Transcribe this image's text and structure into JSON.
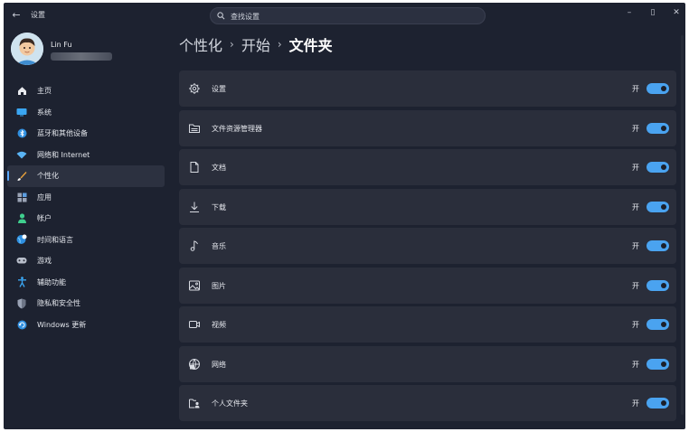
{
  "window": {
    "app_title": "设置",
    "back_glyph": "←",
    "search_placeholder": "查找设置",
    "minimize_glyph": "–",
    "maximize_glyph": "▯",
    "close_glyph": "✕"
  },
  "profile": {
    "name": "Lin Fu"
  },
  "sidebar": {
    "items": [
      {
        "label": "主页",
        "icon": "home-icon"
      },
      {
        "label": "系统",
        "icon": "monitor-icon"
      },
      {
        "label": "蓝牙和其他设备",
        "icon": "bluetooth-icon"
      },
      {
        "label": "网络和 Internet",
        "icon": "wifi-icon"
      },
      {
        "label": "个性化",
        "icon": "brush-icon",
        "active": true
      },
      {
        "label": "应用",
        "icon": "apps-icon"
      },
      {
        "label": "帐户",
        "icon": "person-icon"
      },
      {
        "label": "时间和语言",
        "icon": "globe-clock-icon"
      },
      {
        "label": "游戏",
        "icon": "gamepad-icon"
      },
      {
        "label": "辅助功能",
        "icon": "accessibility-icon"
      },
      {
        "label": "隐私和安全性",
        "icon": "shield-icon"
      },
      {
        "label": "Windows 更新",
        "icon": "update-icon"
      }
    ]
  },
  "breadcrumb": {
    "parts": [
      "个性化",
      "开始",
      "文件夹"
    ],
    "separator": "›"
  },
  "folders": {
    "state_label": "开",
    "rows": [
      {
        "label": "设置",
        "icon": "gear-icon",
        "on": true
      },
      {
        "label": "文件资源管理器",
        "icon": "folder-icon",
        "on": true
      },
      {
        "label": "文档",
        "icon": "document-icon",
        "on": true
      },
      {
        "label": "下载",
        "icon": "download-icon",
        "on": true
      },
      {
        "label": "音乐",
        "icon": "music-icon",
        "on": true
      },
      {
        "label": "图片",
        "icon": "picture-icon",
        "on": true
      },
      {
        "label": "视频",
        "icon": "video-icon",
        "on": true
      },
      {
        "label": "网络",
        "icon": "network-icon",
        "on": true
      },
      {
        "label": "个人文件夹",
        "icon": "personal-folder-icon",
        "on": true
      }
    ]
  },
  "colors": {
    "accent": "#4aa3f0",
    "window_bg": "#1d2230",
    "card_bg": "#2a2e3b"
  }
}
